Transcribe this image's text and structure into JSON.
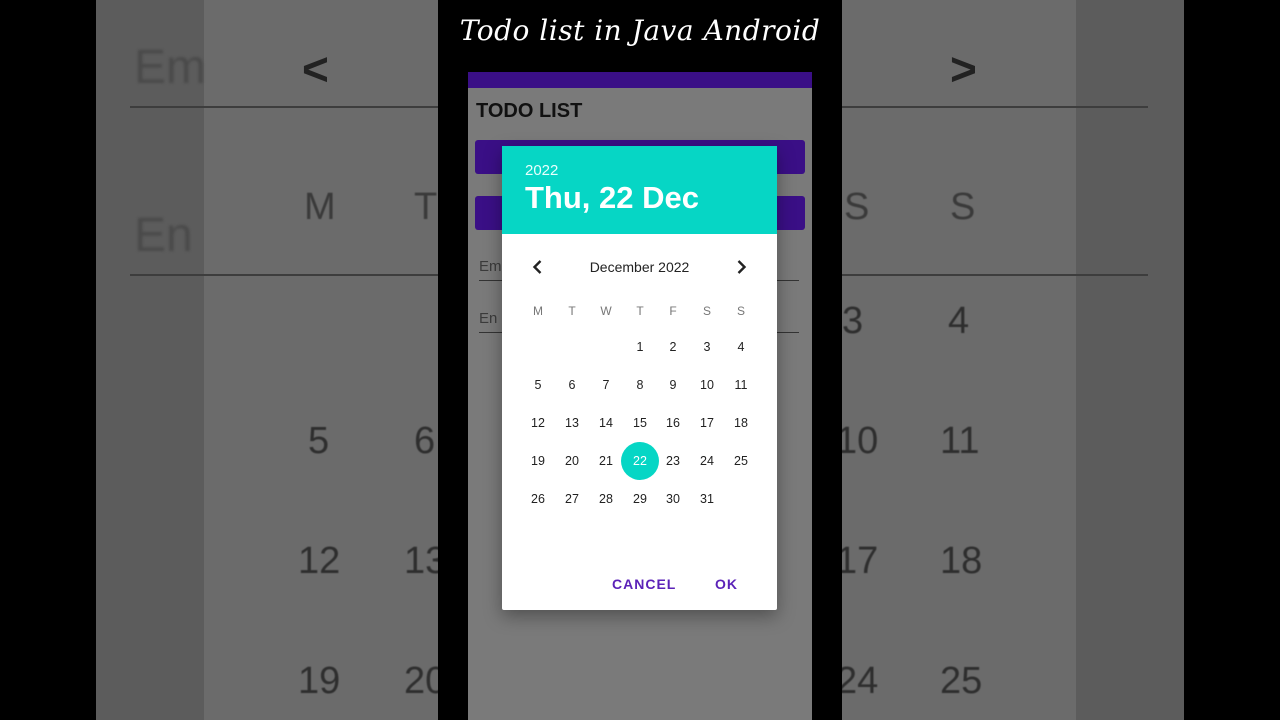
{
  "video_title": "Todo list in Java Android",
  "app": {
    "title": "TODO LIST",
    "field1_hint": "Em",
    "field2_hint": "En"
  },
  "background": {
    "left_hints": [
      "Em",
      "En"
    ],
    "left_weekdays": [
      "M",
      "T"
    ],
    "left_days": [
      "5",
      "6",
      "12",
      "13",
      "19",
      "20"
    ],
    "right_weekdays": [
      "S",
      "S"
    ],
    "right_days": [
      "3",
      "4",
      "10",
      "11",
      "17",
      "18",
      "24",
      "25"
    ]
  },
  "dialog": {
    "year": "2022",
    "selected_date": "Thu, 22 Dec",
    "month_label": "December 2022",
    "weekdays": [
      "M",
      "T",
      "W",
      "T",
      "F",
      "S",
      "S"
    ],
    "weeks": [
      [
        "",
        "",
        "",
        "1",
        "2",
        "3",
        "4"
      ],
      [
        "5",
        "6",
        "7",
        "8",
        "9",
        "10",
        "11"
      ],
      [
        "12",
        "13",
        "14",
        "15",
        "16",
        "17",
        "18"
      ],
      [
        "19",
        "20",
        "21",
        "22",
        "23",
        "24",
        "25"
      ],
      [
        "26",
        "27",
        "28",
        "29",
        "30",
        "31",
        ""
      ]
    ],
    "selected_day": "22",
    "cancel_label": "CANCEL",
    "ok_label": "OK"
  },
  "colors": {
    "accent": "#06d6c5",
    "primary": "#3a0f86",
    "button_text": "#5b22b8"
  }
}
